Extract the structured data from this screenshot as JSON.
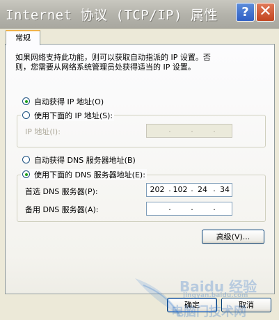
{
  "window": {
    "title": "Internet 协议 (TCP/IP) 属性"
  },
  "title_buttons": {
    "help": "?",
    "close": "✕"
  },
  "tabs": [
    {
      "label": "常规"
    }
  ],
  "description": [
    "如果网络支持此功能，则可以获取自动指派的 IP 设置。否",
    "则，您需要从网络系统管理员处获得适当的 IP 设置。"
  ],
  "ip": {
    "auto_label": "自动获得 IP 地址(O)",
    "manual_label": "使用下面的 IP 地址(S):",
    "selected": "auto",
    "address_label": "IP 地址(I):",
    "address_octets": [
      "",
      "",
      "",
      ""
    ]
  },
  "dns": {
    "auto_label": "自动获得 DNS 服务器地址(B)",
    "manual_label": "使用下面的 DNS 服务器地址(E):",
    "selected": "manual",
    "preferred_label": "首选 DNS 服务器(P):",
    "preferred_octets": [
      "202",
      "102",
      "24",
      "34"
    ],
    "alternate_label": "备用 DNS 服务器(A):",
    "alternate_octets": [
      "",
      "",
      "",
      ""
    ]
  },
  "buttons": {
    "advanced": "高级(V)...",
    "ok": "确定",
    "cancel": "取消"
  },
  "watermark": {
    "logo": "Baidu 经验",
    "url": "jingyan.baidu.com",
    "line2": "电脑门技术网"
  },
  "colors": {
    "radio_dot": "#21a121",
    "accent_tab": "#f0b34a",
    "field_border": "#7f9db9"
  }
}
